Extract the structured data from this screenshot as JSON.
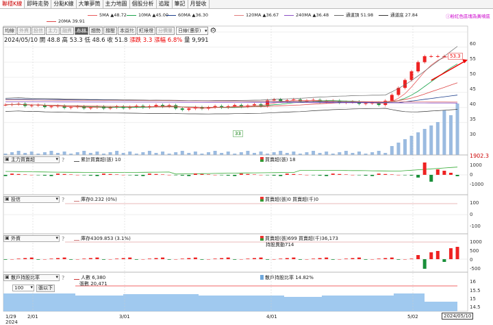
{
  "tabs": [
    {
      "label": "聯穩K線",
      "active": true
    },
    {
      "label": "即時走勢"
    },
    {
      "label": "分點K線"
    },
    {
      "label": "大筆夢筒"
    },
    {
      "label": "主力地圖"
    },
    {
      "label": "個股分析"
    },
    {
      "label": "追蹤"
    },
    {
      "label": "筆記"
    },
    {
      "label": "月營收"
    }
  ],
  "ma_legend": [
    {
      "label": "5MA ▲48.72",
      "color": "#e8595a"
    },
    {
      "label": "10MA ▲45.00",
      "color": "#18a34a"
    },
    {
      "label": "60MA ▲36.30",
      "color": "#1a3c8a"
    },
    {
      "label": "120MA ▲36.67",
      "color": "#e27a7a"
    },
    {
      "label": "240MA ▲36.48",
      "color": "#8a4dc4"
    },
    {
      "label": "20MA 39.91",
      "color": "#d44"
    }
  ],
  "channel_legend": [
    {
      "label": "通道頂 51.98",
      "color": "#666"
    },
    {
      "label": "通道底 27.84",
      "color": "#333"
    }
  ],
  "note": "粉紅色區塊為黃噴區",
  "toolbar": {
    "buttons": [
      {
        "label": "均線"
      },
      {
        "label": "外資",
        "dim": true
      },
      {
        "label": "投信",
        "dim": true
      },
      {
        "label": "主力",
        "dim": true
      },
      {
        "label": "融資",
        "dim": true
      },
      {
        "label": "布林",
        "active": true
      },
      {
        "label": "趨勢"
      },
      {
        "label": "撐壓"
      },
      {
        "label": "本益比"
      },
      {
        "label": "紅綠燈"
      },
      {
        "label": "分價量",
        "dim": true
      }
    ],
    "select": "日線(還原)"
  },
  "ohlc": {
    "date": "2024/05/10",
    "open": "開 48.8",
    "high": "高 53.3",
    "low": "低 48.6",
    "close": "收 51.8",
    "change": "漲跌 3.3",
    "pct": "漲幅 6.8%",
    "volume": "量 9,991"
  },
  "main_annotations": {
    "high": "53.3",
    "low": "33"
  },
  "main_axis": [
    "60",
    "55",
    "50",
    "45",
    "40",
    "35",
    "30"
  ],
  "panels": {
    "p1": {
      "select": "主力買賣超",
      "line_label": "累計買賣超(張) 10",
      "bar_label": "買賣超(張) 18",
      "top_value": "1902.3",
      "axis": [
        "1000",
        "0",
        "-1000"
      ]
    },
    "p2": {
      "select": "投信",
      "line_label": "庫存0.232 (0%)",
      "bar_label": "買賣超(張)0 買賣超(千)0",
      "axis": [
        "100",
        "0",
        "-100"
      ]
    },
    "p3": {
      "select": "外資",
      "line_label": "庫存4309.853 (3.1%)",
      "bar_label": "買賣超(張)699 買賣超(千)36,173",
      "bar_label2": "持股異動714",
      "axis": [
        "1000",
        "500",
        "0",
        "-500"
      ]
    },
    "p4": {
      "select": "散戶持股比率",
      "line_label": "人數 6,380",
      "line_label2": "張數 20,471",
      "bar_label": "散戶持股比率 14.82%",
      "axis": [
        "16",
        "15.5",
        "15",
        "14.5"
      ],
      "filter_value": "100",
      "filter_btn": "張以下"
    }
  },
  "x_labels": [
    {
      "label": "1/29\n2024"
    },
    {
      "label": "2/01"
    },
    {
      "label": "3/01"
    },
    {
      "label": "4/01"
    },
    {
      "label": "5/02"
    }
  ],
  "current_date": "2024/05/10"
}
